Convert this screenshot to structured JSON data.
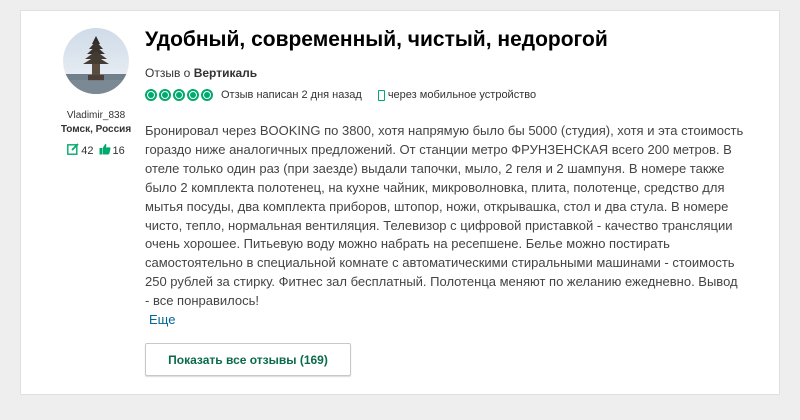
{
  "reviewer": {
    "username": "Vladimir_838",
    "location": "Томск, Россия",
    "contributions": "42",
    "helpful_votes": "16"
  },
  "review": {
    "title": "Удобный, современный, чистый, недорогой",
    "about_prefix": "Отзыв о ",
    "about_hotel": "Вертикаль",
    "rating": 5,
    "rating_max": 5,
    "written": "Отзыв написан 2 дня назад",
    "via": "через мобильное устройство",
    "text": "Бронировал через BOOKING по 3800, хотя напрямую было бы 5000 (студия), хотя и эта стоимость гораздо ниже аналогичных предложений. От станции метро ФРУНЗЕНСКАЯ всего 200 метров. В отеле только один раз (при заезде) выдали тапочки, мыло, 2 геля и 2 шампуня. В номере также было 2 комплекта полотенец, на кухне чайник, микроволновка, плита, полотенце, средство для мытья посуды, два комплекта приборов, штопор, ножи, открывашка, стол и два стула. В номере чисто, тепло, нормальная вентиляция. Телевизор с цифровой приставкой - качество трансляции очень хорошее. Питьевую воду можно набрать на ресепшене. Белье можно постирать самостоятельно в специальной комнате с автоматическими стиральными машинами - стоимость 250 рублей за стирку. Фитнес зал бесплатный. Полотенца меняют по желанию ежедневно. Вывод - все понравилось!",
    "more_label": "Еще"
  },
  "actions": {
    "show_all_label": "Показать все отзывы (169)"
  },
  "colors": {
    "accent": "#00aa6c",
    "link": "#006699",
    "button_text": "#0a6b4a"
  },
  "icons": {
    "contributions": "review-pencil-icon",
    "helpful": "thumbs-up-icon",
    "mobile": "mobile-phone-icon"
  }
}
